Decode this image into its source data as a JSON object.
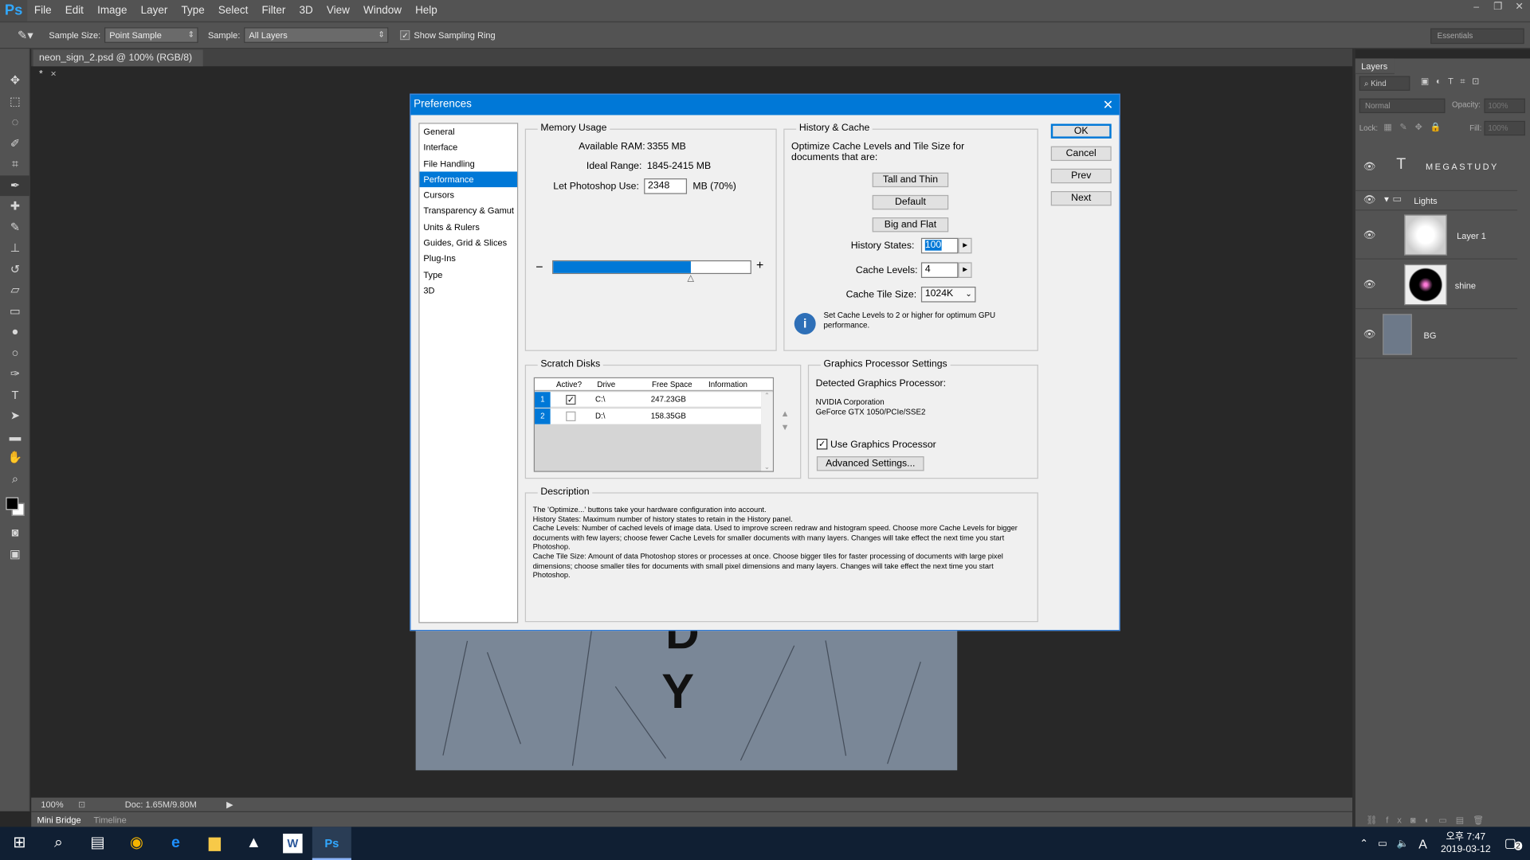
{
  "app": {
    "logo": "Ps"
  },
  "menu": [
    "File",
    "Edit",
    "Image",
    "Layer",
    "Type",
    "Select",
    "Filter",
    "3D",
    "View",
    "Window",
    "Help"
  ],
  "window_controls": [
    "–",
    "❐",
    "✕"
  ],
  "options": {
    "sample_size_label": "Sample Size:",
    "sample_size_value": "Point Sample",
    "sample_label": "Sample:",
    "sample_value": "All Layers",
    "show_ring_label": "Show Sampling Ring",
    "workspace": "Essentials"
  },
  "document": {
    "tab": "neon_sign_2.psd @ 100% (RGB/8) *",
    "letters": [
      "D",
      "Y"
    ]
  },
  "status": {
    "zoom": "100%",
    "doc": "Doc: 1.65M/9.80M"
  },
  "bottom_tabs": [
    "Mini Bridge",
    "Timeline"
  ],
  "layers_panel": {
    "tab": "Layers",
    "filter": "Kind",
    "blend_mode": "Normal",
    "opacity_label": "Opacity:",
    "opacity_value": "100%",
    "lock_label": "Lock:",
    "fill_label": "Fill:",
    "fill_value": "100%",
    "layers": [
      {
        "name": "MEGASTUDY",
        "kind": "text"
      },
      {
        "name": "Lights",
        "kind": "group"
      },
      {
        "name": "Layer 1",
        "kind": "pixel"
      },
      {
        "name": "shine",
        "kind": "pixel"
      },
      {
        "name": "BG",
        "kind": "pixel"
      }
    ]
  },
  "taskbar": {
    "time": "오후 7:47",
    "date": "2019-03-12",
    "ime": "A",
    "notif_count": "2"
  },
  "dialog": {
    "title": "Preferences",
    "categories": [
      "General",
      "Interface",
      "File Handling",
      "Performance",
      "Cursors",
      "Transparency & Gamut",
      "Units & Rulers",
      "Guides, Grid & Slices",
      "Plug-Ins",
      "Type",
      "3D"
    ],
    "selected_category": "Performance",
    "buttons": {
      "ok": "OK",
      "cancel": "Cancel",
      "prev": "Prev",
      "next": "Next"
    },
    "memory": {
      "title": "Memory Usage",
      "available_label": "Available RAM:",
      "available_value": "3355 MB",
      "ideal_label": "Ideal Range:",
      "ideal_value": "1845-2415 MB",
      "let_label": "Let Photoshop Use:",
      "let_value": "2348",
      "let_unit": "MB (70%)",
      "slider_fraction": 0.7,
      "minus": "−",
      "plus": "+"
    },
    "history": {
      "title": "History & Cache",
      "desc": "Optimize Cache Levels and Tile Size for documents that are:",
      "tall_thin": "Tall and Thin",
      "default": "Default",
      "big_flat": "Big and Flat",
      "states_label": "History States:",
      "states_value": "100",
      "levels_label": "Cache Levels:",
      "levels_value": "4",
      "tile_label": "Cache Tile Size:",
      "tile_value": "1024K",
      "info": "Set Cache Levels to 2 or higher for optimum GPU performance."
    },
    "scratch": {
      "title": "Scratch Disks",
      "columns": [
        "Active?",
        "Drive",
        "Free Space",
        "Information"
      ],
      "rows": [
        {
          "num": "1",
          "active": true,
          "drive": "C:\\",
          "free": "247.23GB",
          "info": ""
        },
        {
          "num": "2",
          "active": false,
          "drive": "D:\\",
          "free": "158.35GB",
          "info": ""
        }
      ]
    },
    "gpu": {
      "title": "Graphics Processor Settings",
      "detected_label": "Detected Graphics Processor:",
      "vendor": "NVIDIA Corporation",
      "model": "GeForce GTX 1050/PCIe/SSE2",
      "use_label": "Use Graphics Processor",
      "advanced": "Advanced Settings..."
    },
    "description": {
      "title": "Description",
      "lines": [
        "The 'Optimize...' buttons take your hardware configuration into account.",
        "History States: Maximum number of history states to retain in the History panel.",
        "Cache Levels: Number of cached levels of image data.  Used to improve screen redraw and histogram speed.  Choose more Cache Levels for bigger documents with few layers; choose fewer Cache Levels for smaller documents with many layers. Changes will take effect the next time you start Photoshop.",
        "Cache Tile Size: Amount of data Photoshop stores or processes at once. Choose bigger tiles for faster processing of documents with large pixel dimensions; choose smaller tiles for documents with small pixel dimensions and many layers. Changes will take effect the next time you start Photoshop."
      ]
    }
  }
}
